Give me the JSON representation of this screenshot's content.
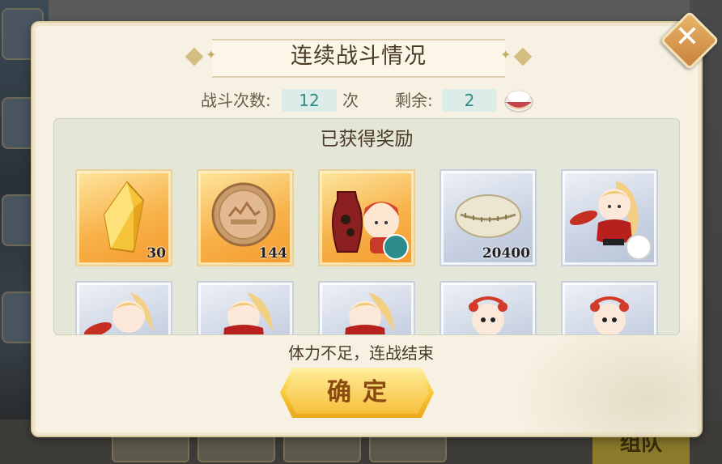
{
  "background": {
    "team_button_label": "组队"
  },
  "dialog": {
    "title": "连续战斗情况",
    "battle_count_label": "战斗次数:",
    "battle_count_value": "12",
    "battle_count_unit": "次",
    "remaining_label": "剩余:",
    "remaining_value": "2",
    "rewards_heading": "已获得奖励",
    "status_text": "体力不足，连战结束",
    "confirm_label": "确定",
    "close_icon": "close-icon"
  },
  "rewards": [
    {
      "name": "gold-crystal",
      "rarity": "gold",
      "count": "30"
    },
    {
      "name": "copper-coin",
      "rarity": "gold",
      "count": "144"
    },
    {
      "name": "red-vase-skin",
      "rarity": "gold",
      "count": "",
      "badge": "teal"
    },
    {
      "name": "shell-currency",
      "rarity": "blue",
      "count": "20400"
    },
    {
      "name": "chibi-character-fan",
      "rarity": "blue",
      "count": "",
      "badge": "red"
    },
    {
      "name": "chibi-character-fan",
      "rarity": "blue",
      "count": ""
    },
    {
      "name": "chibi-character-red",
      "rarity": "blue",
      "count": ""
    },
    {
      "name": "chibi-character-red",
      "rarity": "blue",
      "count": ""
    },
    {
      "name": "chibi-lion-dance",
      "rarity": "blue",
      "count": ""
    },
    {
      "name": "chibi-lion-dance",
      "rarity": "blue",
      "count": ""
    }
  ],
  "colors": {
    "accent_teal": "#2f8c84",
    "confirm_gold": "#f7c03b",
    "text_brown": "#4a3a26"
  }
}
